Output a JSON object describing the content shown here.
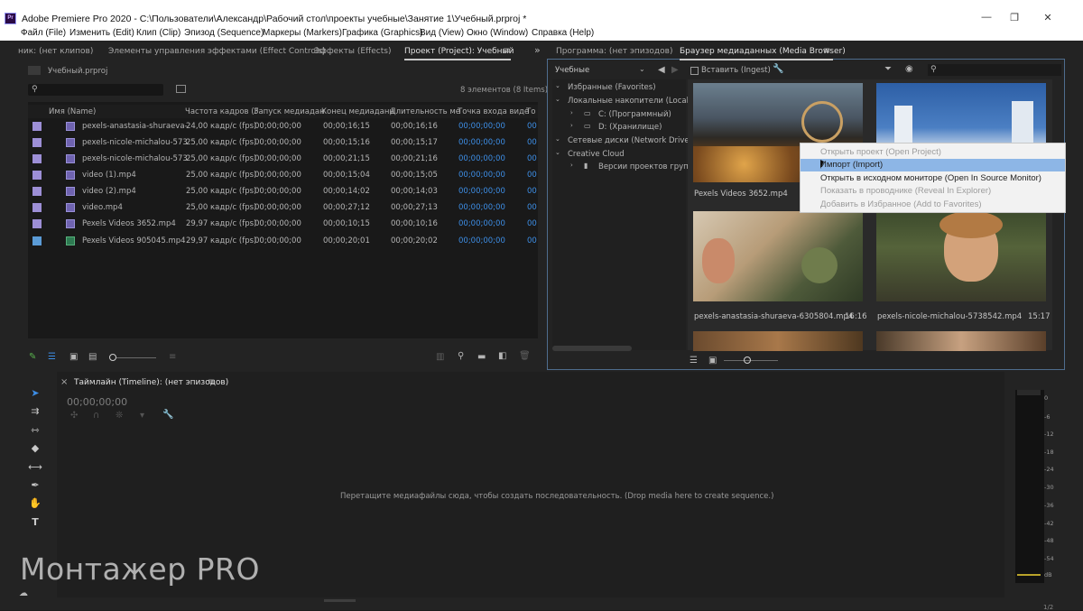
{
  "window": {
    "title": "Adobe Premiere Pro 2020 - C:\\Пользователи\\Александр\\Рабочий стол\\проекты учебные\\Занятие 1\\Учебный.prproj *",
    "logo": "Pr",
    "minimize": "—",
    "restore": "❐",
    "close": "✕"
  },
  "menu": [
    "Файл (File)",
    "Изменить (Edit)",
    "Клип (Clip)",
    "Эпизод (Sequence)",
    "Маркеры (Markers)",
    "Графика (Graphics)",
    "Вид (View)",
    "Окно (Window)",
    "Справка (Help)"
  ],
  "left_panel": {
    "tabs": [
      "ник: (нет клипов)",
      "Элементы управления эффектами (Effect Controls)",
      "Эффекты (Effects)",
      "Проект (Project): Учебный"
    ],
    "overflow": "»",
    "project_file": "Учебный.prproj",
    "item_count": "8 элементов (8 Items)",
    "columns": [
      "Имя (Name)",
      "Частота кадров (F",
      "Запуск медиадан",
      "Конец медиаданн",
      "Длительность ме",
      "Точка входа виде",
      "То"
    ],
    "rows": [
      {
        "name": "pexels-anastasia-shuraeva-",
        "fps": "24,00 кадр/с (fps)",
        "start": "00;00;00;00",
        "end": "00;00;16;15",
        "dur": "00;00;16;16",
        "in": "00;00;00;00",
        "to": "00"
      },
      {
        "name": "pexels-nicole-michalou-573",
        "fps": "25,00 кадр/с (fps)",
        "start": "00;00;00;00",
        "end": "00;00;15;16",
        "dur": "00;00;15;17",
        "in": "00;00;00;00",
        "to": "00"
      },
      {
        "name": "pexels-nicole-michalou-573",
        "fps": "25,00 кадр/с (fps)",
        "start": "00;00;00;00",
        "end": "00;00;21;15",
        "dur": "00;00;21;16",
        "in": "00;00;00;00",
        "to": "00"
      },
      {
        "name": "video (1).mp4",
        "fps": "25,00 кадр/с (fps)",
        "start": "00;00;00;00",
        "end": "00;00;15;04",
        "dur": "00;00;15;05",
        "in": "00;00;00;00",
        "to": "00"
      },
      {
        "name": "video (2).mp4",
        "fps": "25,00 кадр/с (fps)",
        "start": "00;00;00;00",
        "end": "00;00;14;02",
        "dur": "00;00;14;03",
        "in": "00;00;00;00",
        "to": "00"
      },
      {
        "name": "video.mp4",
        "fps": "25,00 кадр/с (fps)",
        "start": "00;00;00;00",
        "end": "00;00;27;12",
        "dur": "00;00;27;13",
        "in": "00;00;00;00",
        "to": "00"
      },
      {
        "name": "Pexels Videos 3652.mp4",
        "fps": "29,97 кадр/с (fps)",
        "start": "00;00;00;00",
        "end": "00;00;10;15",
        "dur": "00;00;10;16",
        "in": "00;00;00;00",
        "to": "00"
      },
      {
        "name": "Pexels Videos 905045.mp4",
        "fps": "29,97 кадр/с (fps)",
        "start": "00;00;00;00",
        "end": "00;00;20;01",
        "dur": "00;00;20;02",
        "in": "00;00;00;00",
        "to": "00"
      }
    ]
  },
  "right_panel": {
    "tabs": [
      "Программа: (нет эпизодов)",
      "Браузер медиаданных (Media Browser)"
    ],
    "location": "Учебные",
    "ingest": "Вставить (Ingest)",
    "tree": [
      "Избранные (Favorites)",
      "Локальные накопители (Local Driv",
      "C: (Программный)",
      "D: (Хранилище)",
      "Сетевые диски (Network Drives)",
      "Creative Cloud",
      "Версии проектов группы"
    ],
    "thumbs": [
      {
        "name": "Pexels Videos 3652.mp4",
        "duration": ""
      },
      {
        "name": "",
        "duration": ""
      },
      {
        "name": "pexels-anastasia-shuraeva-6305804.mp4",
        "duration": "16:16"
      },
      {
        "name": "pexels-nicole-michalou-5738542.mp4",
        "duration": "15:17"
      }
    ]
  },
  "context_menu": {
    "items": [
      "Открыть проект (Open Project)",
      "Импорт (Import)",
      "Открыть в исходном мониторе (Open In Source Monitor)",
      "Показать в проводнике (Reveal In Explorer)",
      "Добавить в Избранное (Add to Favorites)"
    ],
    "highlighted_index": 1
  },
  "timeline": {
    "close": "×",
    "title": "Таймлайн (Timeline): (нет эпизодов)",
    "timecode": "00;00;00;00",
    "hint": "Перетащите медиафайлы сюда, чтобы создать последовательность. (Drop media here to create sequence.)"
  },
  "meter_ticks": [
    "0",
    "-6",
    "-12",
    "-18",
    "-24",
    "-30",
    "-36",
    "-42",
    "-48",
    "-54",
    "dB"
  ],
  "status": {
    "corner": "1/2"
  },
  "watermark": "Монтажер PRO"
}
